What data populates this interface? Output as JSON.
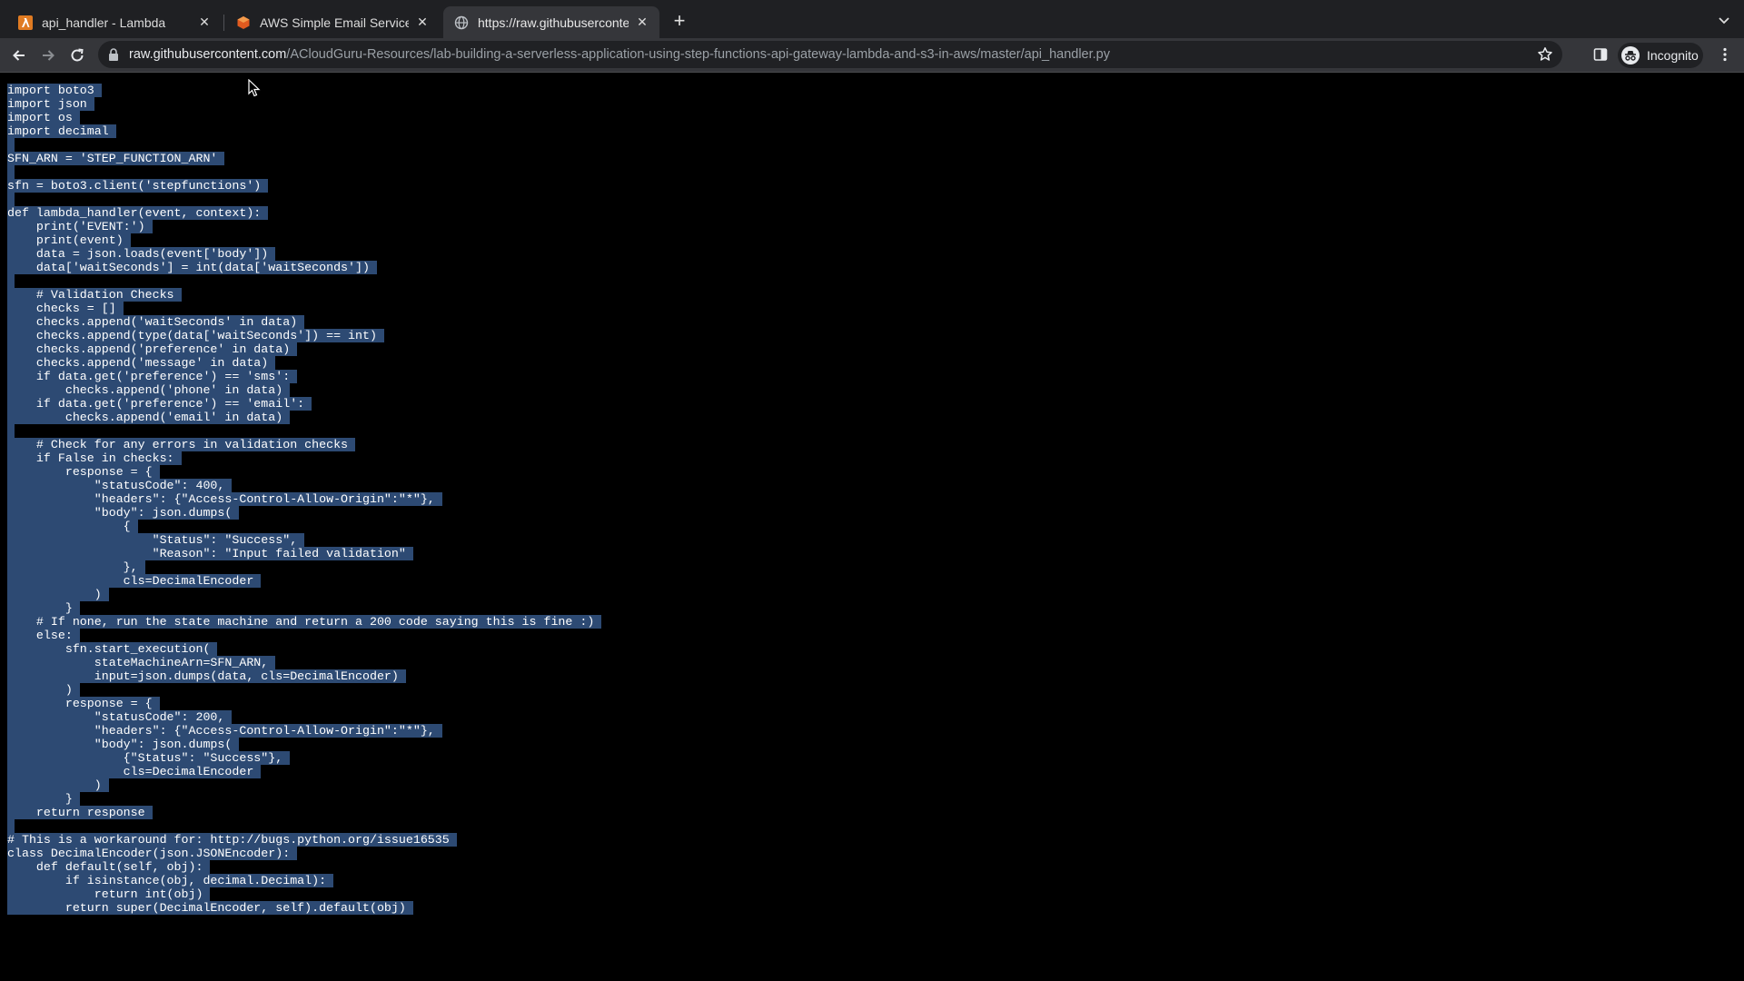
{
  "browser": {
    "tabs": [
      {
        "title": "api_handler - Lambda",
        "icon": "aws-lambda-icon",
        "active": false
      },
      {
        "title": "AWS Simple Email Service - De",
        "icon": "aws-ses-icon",
        "active": false
      },
      {
        "title": "https://raw.githubusercontent.",
        "icon": "globe-icon",
        "active": true
      }
    ],
    "url_host": "raw.githubusercontent.com",
    "url_path": "/ACloudGuru-Resources/lab-building-a-serverless-application-using-step-functions-api-gateway-lambda-and-s3-in-aws/master/api_handler.py",
    "profile_label": "Incognito"
  },
  "code": {
    "lines": [
      "import boto3",
      "import json",
      "import os",
      "import decimal",
      "",
      "SFN_ARN = 'STEP_FUNCTION_ARN'",
      "",
      "sfn = boto3.client('stepfunctions')",
      "",
      "def lambda_handler(event, context):",
      "    print('EVENT:')",
      "    print(event)",
      "    data = json.loads(event['body'])",
      "    data['waitSeconds'] = int(data['waitSeconds'])",
      "",
      "    # Validation Checks",
      "    checks = []",
      "    checks.append('waitSeconds' in data)",
      "    checks.append(type(data['waitSeconds']) == int)",
      "    checks.append('preference' in data)",
      "    checks.append('message' in data)",
      "    if data.get('preference') == 'sms':",
      "        checks.append('phone' in data)",
      "    if data.get('preference') == 'email':",
      "        checks.append('email' in data)",
      "",
      "    # Check for any errors in validation checks",
      "    if False in checks:",
      "        response = {",
      "            \"statusCode\": 400,",
      "            \"headers\": {\"Access-Control-Allow-Origin\":\"*\"},",
      "            \"body\": json.dumps(",
      "                {",
      "                    \"Status\": \"Success\",",
      "                    \"Reason\": \"Input failed validation\"",
      "                },",
      "                cls=DecimalEncoder",
      "            )",
      "        }",
      "    # If none, run the state machine and return a 200 code saying this is fine :)",
      "    else:",
      "        sfn.start_execution(",
      "            stateMachineArn=SFN_ARN,",
      "            input=json.dumps(data, cls=DecimalEncoder)",
      "        )",
      "        response = {",
      "            \"statusCode\": 200,",
      "            \"headers\": {\"Access-Control-Allow-Origin\":\"*\"},",
      "            \"body\": json.dumps(",
      "                {\"Status\": \"Success\"},",
      "                cls=DecimalEncoder",
      "            )",
      "        }",
      "    return response",
      "",
      "# This is a workaround for: http://bugs.python.org/issue16535",
      "class DecimalEncoder(json.JSONEncoder):",
      "    def default(self, obj):",
      "        if isinstance(obj, decimal.Decimal):",
      "            return int(obj)",
      "        return super(DecimalEncoder, self).default(obj)"
    ]
  }
}
